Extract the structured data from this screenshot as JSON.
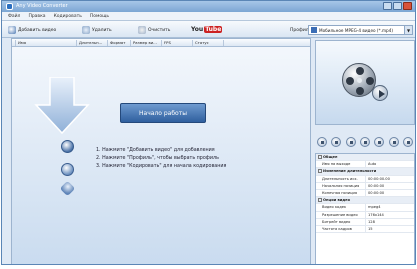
{
  "window": {
    "title": "Any Video Converter"
  },
  "menu": [
    "Файл",
    "Правка",
    "Кодировать",
    "Помощь"
  ],
  "toolbar": {
    "add_video": "Добавить видео",
    "remove": "Удалить",
    "clear": "Очистить",
    "youtube_you": "You",
    "youtube_tube": "Tube",
    "profile_label": "Профиль:",
    "profile_value": "Мобильное MPEG-4 видео (*.mp4)"
  },
  "table": {
    "columns": [
      "Имя",
      "Длительн...",
      "Формат",
      "Размер ви...",
      "FPS",
      "Статус"
    ]
  },
  "main": {
    "start_button": "Начало работы",
    "steps": [
      "1. Нажмите \"Добавить видео\" для добавления",
      "2. Нажмите \"Профиль\", чтобы выбрать профиль",
      "3. Нажмите \"Кодировать\" для начала кодирования"
    ]
  },
  "properties": {
    "groups": [
      {
        "title": "Общее",
        "rows": [
          {
            "key": "Имя на выходе",
            "value": "Auto"
          }
        ]
      },
      {
        "title": "Изменение длительности",
        "rows": [
          {
            "key": "Длительность исх.",
            "value": "00:00:00.00"
          },
          {
            "key": "Начальная позиция",
            "value": "00:00:00"
          },
          {
            "key": "Конечная позиция",
            "value": "00:00:00"
          }
        ]
      },
      {
        "title": "Опции видео",
        "rows": [
          {
            "key": "Видео кодек",
            "value": "mpeg4"
          },
          {
            "key": "Разрешение видео",
            "value": "176x144"
          },
          {
            "key": "Битрейт видео",
            "value": "128"
          },
          {
            "key": "Частота кадров",
            "value": "15"
          }
        ]
      }
    ]
  }
}
